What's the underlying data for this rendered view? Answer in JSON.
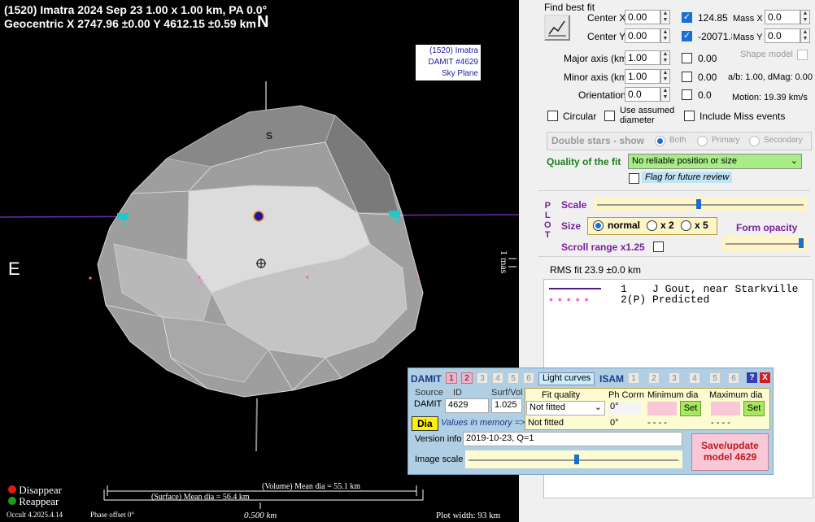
{
  "plot": {
    "header_line1": "(1520) Imatra  2024 Sep 23   1.00 x 1.00 km, PA 0.0°",
    "header_line2": "Geocentric  X  2747.96 ±0.00  Y 4612.15 ±0.59 km",
    "north_label": "N",
    "east_label": "E",
    "south_label": "S",
    "tag_lines": [
      "(1520) Imatra",
      "DAMIT #4629",
      "Sky Plane"
    ],
    "scale_label": "1 mas",
    "chord_labels": [
      "1",
      "1"
    ],
    "event_label": "2",
    "legend": [
      {
        "text": "Disappear",
        "color": "#e81818"
      },
      {
        "text": "Reappear",
        "color": "#18a018"
      }
    ],
    "volume_dia": "(Volume) Mean dia = 55.1 km",
    "surface_dia": "(Surface) Mean dia = 56.4 km",
    "scalebar_label": "0.500 km",
    "version": "Occult 4.2025.4.14",
    "phase_offset": "Phase offset 0°",
    "plot_width": "Plot width: 93 km"
  },
  "fit": {
    "find_best_fit": "Find best fit",
    "center_x_label": "Center X",
    "center_x": "0.00",
    "center_y_label": "Center Y",
    "center_y": "0.00",
    "center_x_checked_value": "124.85",
    "center_y_checked_value": "-20071.8",
    "mass_x_label": "Mass X",
    "mass_x": "0.0",
    "mass_y_label": "Mass Y",
    "mass_y": "0.0",
    "major_label": "Major axis (km)",
    "major": "1.00",
    "major_val": "0.00",
    "minor_label": "Minor axis (km)",
    "minor": "1.00",
    "minor_val": "0.00",
    "orientation_label": "Orientation",
    "orientation": "0.0",
    "orientation_val": "0.0",
    "shape_model": "Shape model",
    "ab_dmag": "a/b: 1.00, dMag: 0.00",
    "motion": "Motion: 19.39 km/s",
    "circular": "Circular",
    "use_assumed": "Use assumed diameter",
    "include_miss": "Include Miss events",
    "double_stars": "Double stars - show",
    "both": "Both",
    "primary": "Primary",
    "secondary": "Secondary",
    "quality_label": "Quality of the fit",
    "quality_value": "No reliable position or size",
    "flag_review": "Flag for future review"
  },
  "plotctl": {
    "plot_letters": [
      "P",
      "L",
      "O",
      "T"
    ],
    "scale": "Scale",
    "size": "Size",
    "normal": "normal",
    "x2": "x 2",
    "x5": "x 5",
    "form_opacity": "Form opacity",
    "scroll_range": "Scroll range x1.25",
    "scale_level": 0.5,
    "opacity_level": 0.95
  },
  "rms": "RMS fit 23.9 ±0.0 km",
  "chords": [
    {
      "num": "1",
      "text": "J Gout, near Starkville"
    },
    {
      "num": "2(P)",
      "text": "Predicted"
    }
  ],
  "damit": {
    "damit_label": "DAMIT",
    "damit_tabs": [
      "1",
      "2",
      "3",
      "4",
      "5",
      "6"
    ],
    "light_curves": "Light curves",
    "isam_label": "ISAM",
    "isam_tabs": [
      "1",
      "2",
      "3",
      "4",
      "5",
      "6"
    ],
    "help": "?",
    "close": "X",
    "source_hdr": "Source",
    "id_hdr": "ID",
    "surfvol_hdr": "Surf/Vol",
    "fit_quality_hdr": "Fit quality",
    "ph_corrn_hdr": "Ph Corrn",
    "min_dia_hdr": "Minimum dia",
    "max_dia_hdr": "Maximum dia",
    "source": "DAMIT",
    "id": "4629",
    "surfvol": "1.025",
    "fit_quality": "Not fitted",
    "ph_corrn": "0°",
    "set": "Set",
    "dia_btn": "Dia",
    "values_in_memory": "Values in memory =>",
    "mem_fit": "Not fitted",
    "mem_ph": "0°",
    "mem_min": "- - - -",
    "mem_max": "- - - -",
    "version_label": "Version info",
    "version_value": "2019-10-23, Q=1",
    "image_scale": "Image scale",
    "image_scale_level": 0.44,
    "save_update": "Save/update",
    "model": "model 4629"
  }
}
